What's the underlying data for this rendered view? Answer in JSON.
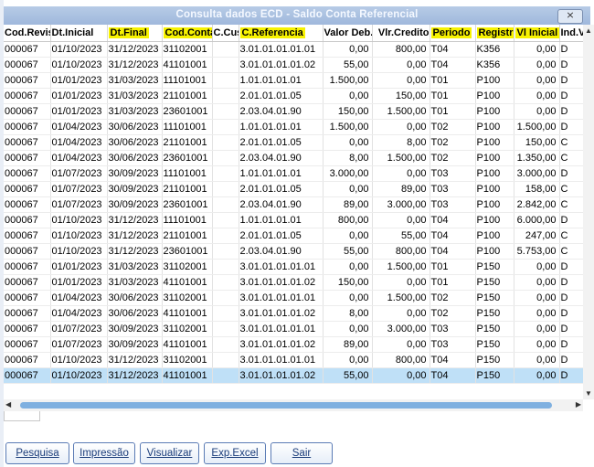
{
  "window": {
    "title": "Consulta dados ECD - Saldo Conta Referencial",
    "close_glyph": "⨯"
  },
  "columns": [
    "Cod.Revis",
    "Dt.Inicial",
    "Dt.Final",
    "Cod.Conta",
    "C.Cus",
    "C.Referencia",
    "Valor Deb.",
    "Vlr.Credito",
    "Periodo",
    "Registr",
    "Vl Inicial",
    "Ind.V"
  ],
  "highlighted_columns": [
    "Dt.Final",
    "Cod.Conta",
    "C.Referencia",
    "Periodo",
    "Registr",
    "Vl Inicial"
  ],
  "rows": [
    [
      "000067",
      "01/10/2023",
      "31/12/2023",
      "31102001",
      "",
      "3.01.01.01.01.01",
      "0,00",
      "800,00",
      "T04",
      "K356",
      "0,00",
      "D"
    ],
    [
      "000067",
      "01/10/2023",
      "31/12/2023",
      "41101001",
      "",
      "3.01.01.01.01.02",
      "55,00",
      "0,00",
      "T04",
      "K356",
      "0,00",
      "D"
    ],
    [
      "000067",
      "01/01/2023",
      "31/03/2023",
      "11101001",
      "",
      "1.01.01.01.01",
      "1.500,00",
      "0,00",
      "T01",
      "P100",
      "0,00",
      "D"
    ],
    [
      "000067",
      "01/01/2023",
      "31/03/2023",
      "21101001",
      "",
      "2.01.01.01.05",
      "0,00",
      "150,00",
      "T01",
      "P100",
      "0,00",
      "D"
    ],
    [
      "000067",
      "01/01/2023",
      "31/03/2023",
      "23601001",
      "",
      "2.03.04.01.90",
      "150,00",
      "1.500,00",
      "T01",
      "P100",
      "0,00",
      "D"
    ],
    [
      "000067",
      "01/04/2023",
      "30/06/2023",
      "11101001",
      "",
      "1.01.01.01.01",
      "1.500,00",
      "0,00",
      "T02",
      "P100",
      "1.500,00",
      "D"
    ],
    [
      "000067",
      "01/04/2023",
      "30/06/2023",
      "21101001",
      "",
      "2.01.01.01.05",
      "0,00",
      "8,00",
      "T02",
      "P100",
      "150,00",
      "C"
    ],
    [
      "000067",
      "01/04/2023",
      "30/06/2023",
      "23601001",
      "",
      "2.03.04.01.90",
      "8,00",
      "1.500,00",
      "T02",
      "P100",
      "1.350,00",
      "C"
    ],
    [
      "000067",
      "01/07/2023",
      "30/09/2023",
      "11101001",
      "",
      "1.01.01.01.01",
      "3.000,00",
      "0,00",
      "T03",
      "P100",
      "3.000,00",
      "D"
    ],
    [
      "000067",
      "01/07/2023",
      "30/09/2023",
      "21101001",
      "",
      "2.01.01.01.05",
      "0,00",
      "89,00",
      "T03",
      "P100",
      "158,00",
      "C"
    ],
    [
      "000067",
      "01/07/2023",
      "30/09/2023",
      "23601001",
      "",
      "2.03.04.01.90",
      "89,00",
      "3.000,00",
      "T03",
      "P100",
      "2.842,00",
      "C"
    ],
    [
      "000067",
      "01/10/2023",
      "31/12/2023",
      "11101001",
      "",
      "1.01.01.01.01",
      "800,00",
      "0,00",
      "T04",
      "P100",
      "6.000,00",
      "D"
    ],
    [
      "000067",
      "01/10/2023",
      "31/12/2023",
      "21101001",
      "",
      "2.01.01.01.05",
      "0,00",
      "55,00",
      "T04",
      "P100",
      "247,00",
      "C"
    ],
    [
      "000067",
      "01/10/2023",
      "31/12/2023",
      "23601001",
      "",
      "2.03.04.01.90",
      "55,00",
      "800,00",
      "T04",
      "P100",
      "5.753,00",
      "C"
    ],
    [
      "000067",
      "01/01/2023",
      "31/03/2023",
      "31102001",
      "",
      "3.01.01.01.01.01",
      "0,00",
      "1.500,00",
      "T01",
      "P150",
      "0,00",
      "D"
    ],
    [
      "000067",
      "01/01/2023",
      "31/03/2023",
      "41101001",
      "",
      "3.01.01.01.01.02",
      "150,00",
      "0,00",
      "T01",
      "P150",
      "0,00",
      "D"
    ],
    [
      "000067",
      "01/04/2023",
      "30/06/2023",
      "31102001",
      "",
      "3.01.01.01.01.01",
      "0,00",
      "1.500,00",
      "T02",
      "P150",
      "0,00",
      "D"
    ],
    [
      "000067",
      "01/04/2023",
      "30/06/2023",
      "41101001",
      "",
      "3.01.01.01.01.02",
      "8,00",
      "0,00",
      "T02",
      "P150",
      "0,00",
      "D"
    ],
    [
      "000067",
      "01/07/2023",
      "30/09/2023",
      "31102001",
      "",
      "3.01.01.01.01.01",
      "0,00",
      "3.000,00",
      "T03",
      "P150",
      "0,00",
      "D"
    ],
    [
      "000067",
      "01/07/2023",
      "30/09/2023",
      "41101001",
      "",
      "3.01.01.01.01.02",
      "89,00",
      "0,00",
      "T03",
      "P150",
      "0,00",
      "D"
    ],
    [
      "000067",
      "01/10/2023",
      "31/12/2023",
      "31102001",
      "",
      "3.01.01.01.01.01",
      "0,00",
      "800,00",
      "T04",
      "P150",
      "0,00",
      "D"
    ],
    [
      "000067",
      "01/10/2023",
      "31/12/2023",
      "41101001",
      "",
      "3.01.01.01.01.02",
      "55,00",
      "0,00",
      "T04",
      "P150",
      "0,00",
      "D"
    ]
  ],
  "selected_row_index": 21,
  "buttons": {
    "pesquisa": "Pesquisa",
    "impressao": "Impressão",
    "visualizar": "Visualizar",
    "exp_excel": "Exp.Excel",
    "sair": "Sair"
  },
  "colors": {
    "highlight": "#f7f200",
    "selected_row": "#bfe0f7",
    "scroll_thumb": "#7fb0e0",
    "titlebar": "#9fb8dc"
  }
}
